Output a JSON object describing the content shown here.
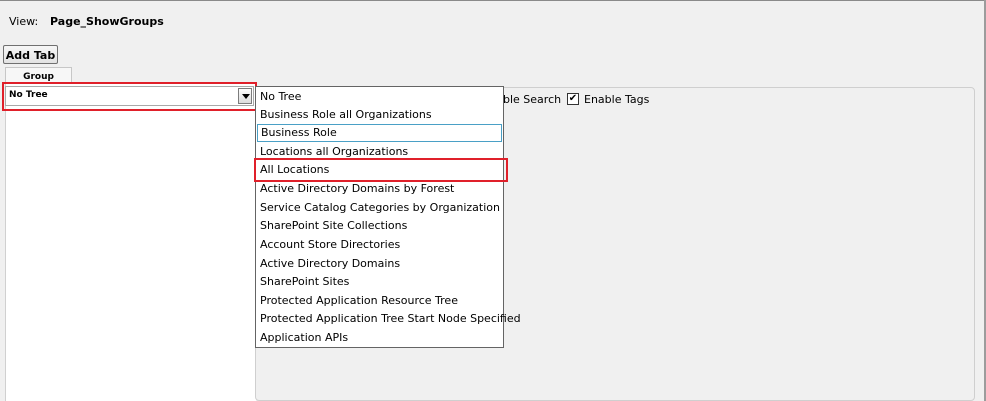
{
  "header": {
    "view_label": "View:",
    "view_value": "Page_ShowGroups"
  },
  "toolbar": {
    "add_tab_label": "Add Tab"
  },
  "tabs": [
    {
      "label": "Group"
    }
  ],
  "tree_select": {
    "selected_value": "No Tree",
    "options": [
      "No Tree",
      "Business Role all Organizations",
      "Business Role",
      "Locations all Organizations",
      "All Locations",
      "Active Directory Domains by Forest",
      "Service Catalog Categories by Organization",
      "SharePoint Site Collections",
      "Account Store Directories",
      "Active Directory Domains",
      "SharePoint Sites",
      "Protected Application Resource Tree",
      "Protected Application Tree Start Node Specified",
      "Application APIs"
    ],
    "focused_option": "Business Role",
    "highlighted_option": "All Locations"
  },
  "options_panel": {
    "enable_search_label": "ble Search",
    "enable_tags_label": "Enable Tags",
    "enable_tags_checked": true
  },
  "colors": {
    "highlight_border": "#e0202a",
    "focus_border": "#4aa0c6"
  }
}
